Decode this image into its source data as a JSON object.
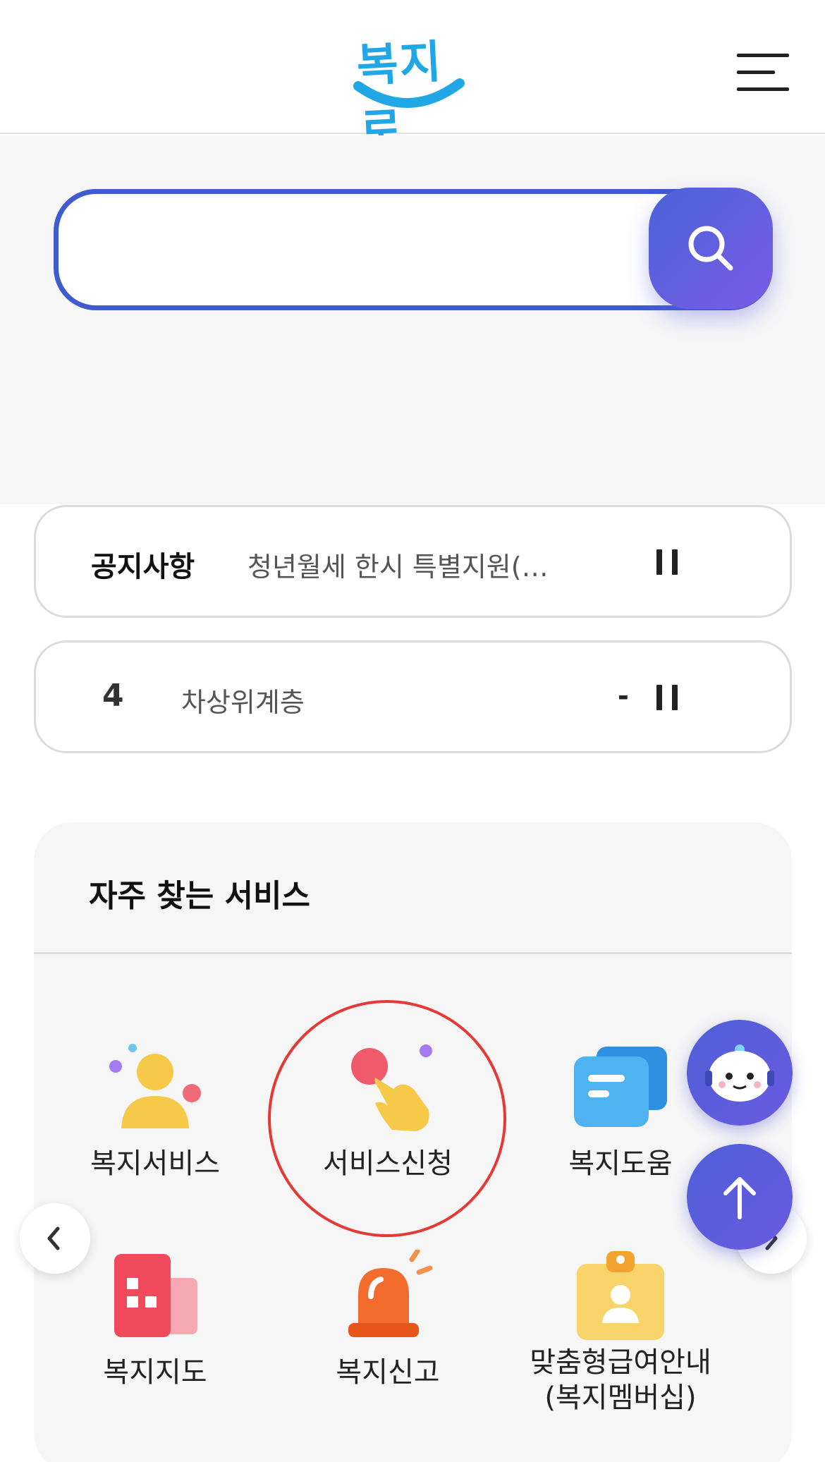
{
  "header": {
    "logo_text": "복지로",
    "menu_icon": "hamburger-menu-icon"
  },
  "search": {
    "value": "",
    "placeholder": "",
    "button_icon": "search-icon",
    "colors": {
      "border": "#3f5bd0",
      "button_start": "#4a63d8",
      "button_end": "#7a5ce6"
    }
  },
  "notice": {
    "label": "공지사항",
    "text": "청년월세 한시 특별지원(…",
    "control_icon": "pause-icon"
  },
  "ranking": {
    "rank": "4",
    "keyword": "차상위계층",
    "change": "-",
    "control_icon": "pause-icon"
  },
  "frequent_services": {
    "title": "자주 찾는 서비스",
    "items": [
      {
        "label": "복지서비스",
        "icon": "person-icon"
      },
      {
        "label": "서비스신청",
        "icon": "pointing-hand-icon"
      },
      {
        "label": "복지도움",
        "icon": "chat-bubble-icon"
      },
      {
        "label": "복지지도",
        "icon": "map-building-icon"
      },
      {
        "label": "복지신고",
        "icon": "siren-icon"
      },
      {
        "label": "맞춤형급여안내",
        "label2": "(복지멤버십)",
        "icon": "clipboard-id-icon"
      }
    ],
    "prev_icon": "chevron-left-icon",
    "next_icon": "chevron-right-icon"
  },
  "floating": {
    "chatbot_icon": "chatbot-robot-icon",
    "top_icon": "arrow-up-icon",
    "color": "#5a5ddc"
  },
  "highlight_color": "#e53935"
}
